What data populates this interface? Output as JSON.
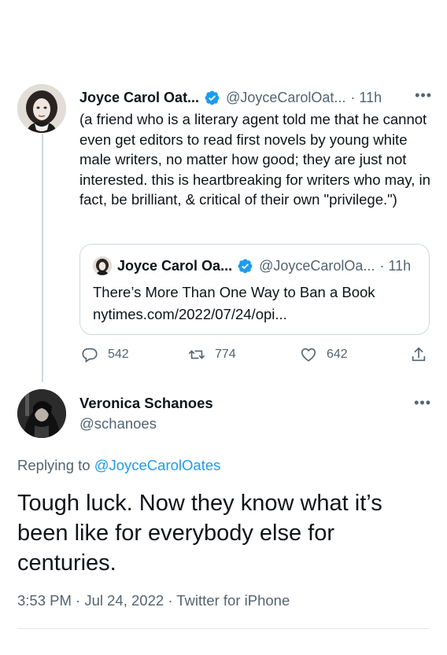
{
  "tweet1": {
    "name": "Joyce Carol Oat...",
    "handle": "@JoyceCarolOat...",
    "time": "11h",
    "text": "(a friend who is a literary agent told me that he cannot even get editors to read first novels by young white male writers, no matter how good; they are just not interested. this is heartbreaking for writers who may, in fact, be brilliant, & critical of their own \"privilege.\")",
    "more_icon": "more-horizontal-icon",
    "quote": {
      "name": "Joyce Carol Oa...",
      "handle": "@JoyceCarolOa...",
      "time": "11h",
      "title": "There’s More Than One Way to Ban a Book",
      "url": "nytimes.com/2022/07/24/opi..."
    },
    "actions": {
      "replies": "542",
      "retweets": "774",
      "likes": "642"
    }
  },
  "tweet2": {
    "name": "Veronica Schanoes",
    "handle": "@schanoes",
    "replying_label": "Replying to",
    "replying_to": "@JoyceCarolOates",
    "text": "Tough luck. Now they know what it’s been like for everybody else for centuries.",
    "time": "3:53 PM",
    "date": "Jul 24, 2022",
    "source": "Twitter for iPhone"
  },
  "colors": {
    "accent": "#1d9bf0",
    "secondary_text": "#536471",
    "border": "#cfd9de"
  }
}
